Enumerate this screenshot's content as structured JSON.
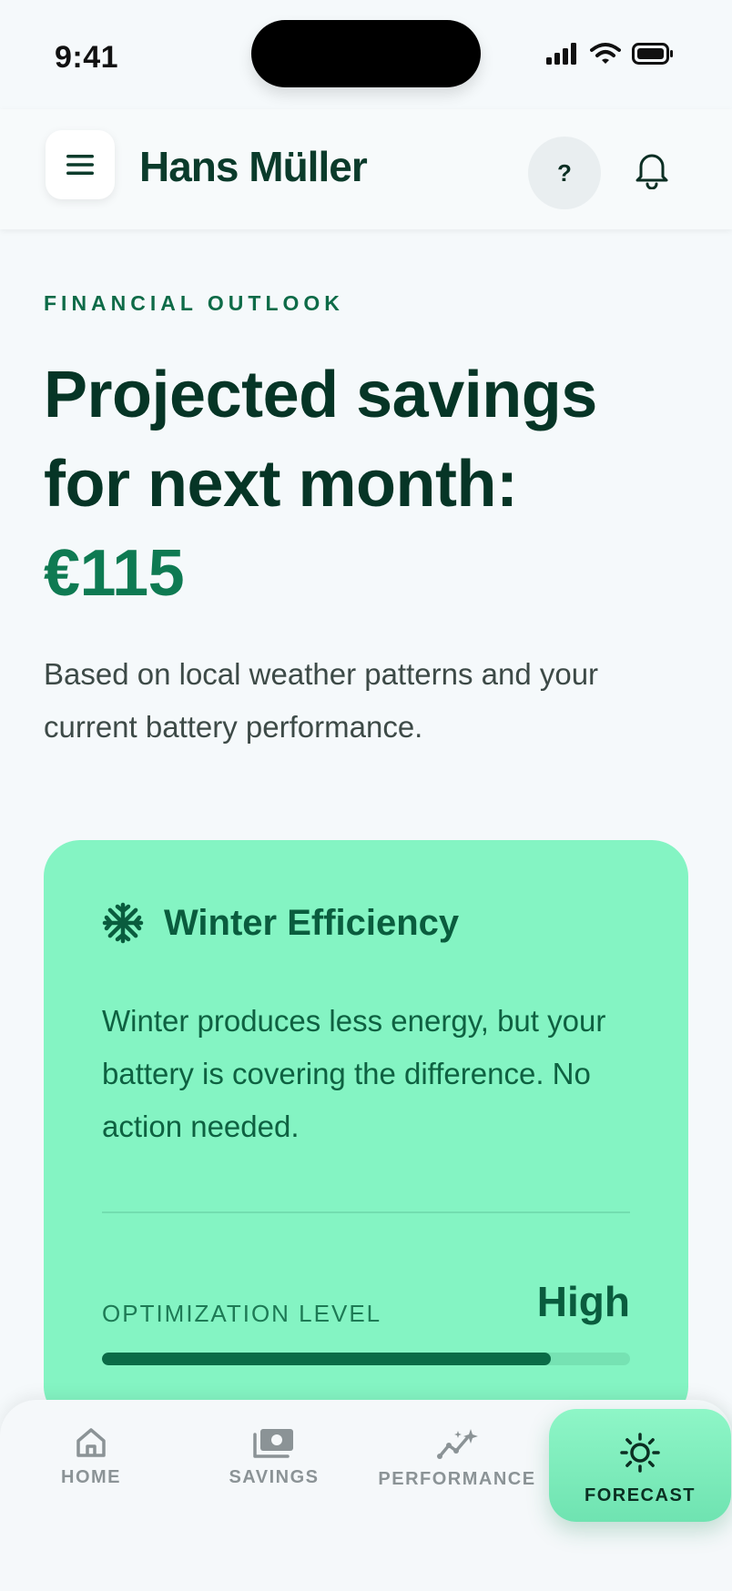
{
  "status_bar": {
    "time": "9:41"
  },
  "header": {
    "user_name": "Hans Müller",
    "help_label": "?"
  },
  "content": {
    "eyebrow": "FINANCIAL OUTLOOK",
    "headline_line1": "Projected savings",
    "headline_line2": "for next month:",
    "amount": "€115",
    "subtext": "Based on local weather patterns and your current battery performance."
  },
  "card": {
    "title": "Winter Efficiency",
    "body": "Winter produces less energy, but your battery is covering the difference. No action needed.",
    "optimization_label": "OPTIMIZATION LEVEL",
    "optimization_value": "High",
    "optimization_progress": 0.85
  },
  "nav": {
    "items": [
      {
        "label": "HOME",
        "icon": "home-icon"
      },
      {
        "label": "SAVINGS",
        "icon": "cash-icon"
      },
      {
        "label": "PERFORMANCE",
        "icon": "chart-sparkle-icon"
      },
      {
        "label": "FORECAST",
        "icon": "sun-icon",
        "active": true
      }
    ]
  },
  "colors": {
    "accent": "#0e7a52",
    "card_bg": "#84f4c3",
    "dark_text": "#063526"
  }
}
